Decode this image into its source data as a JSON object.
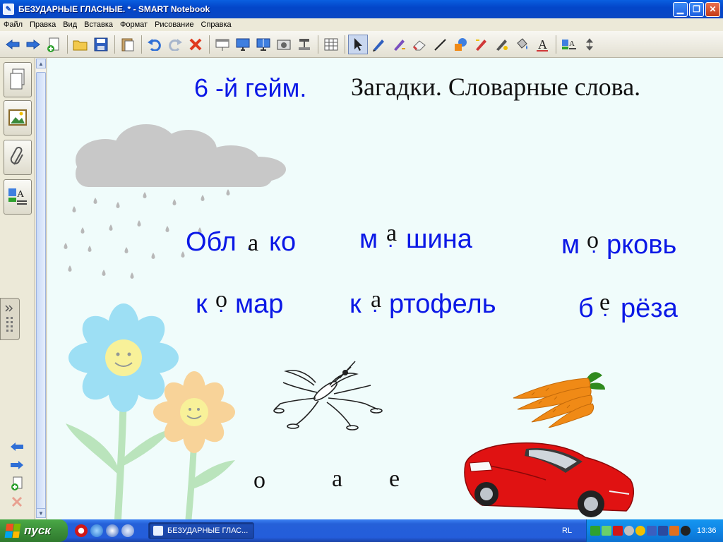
{
  "window": {
    "title": "БЕЗУДАРНЫЕ ГЛАСНЫЕ. * - SMART Notebook",
    "minimize_icon": "minimize-icon",
    "maximize_icon": "restore-icon",
    "close_icon": "close-icon"
  },
  "menu": [
    "Файл",
    "Правка",
    "Вид",
    "Вставка",
    "Формат",
    "Рисование",
    "Справка"
  ],
  "page": {
    "heading_game": "6 -й гейм.",
    "heading_topic": "Загадки. Словарные слова.",
    "words": [
      {
        "prefix": "Обл",
        "missing": "а",
        "suffix": "ко"
      },
      {
        "prefix": "м",
        "missing": "а",
        "suffix": "шина"
      },
      {
        "prefix": "м",
        "missing": "о",
        "suffix": "рковь"
      },
      {
        "prefix": "к",
        "missing": "о",
        "suffix": "мар"
      },
      {
        "prefix": "к",
        "missing": "а",
        "suffix": "ртофель"
      },
      {
        "prefix": "б",
        "missing": "е",
        "suffix": "рёза"
      }
    ],
    "letter_choices": [
      "о",
      "а",
      "е"
    ],
    "colors": {
      "word_blue": "#0b18e6",
      "background": "#f0fcfb",
      "cloud": "#c8c8c8",
      "carrot": "#f08a16",
      "car": "#e01212"
    }
  },
  "taskbar": {
    "start_label": "пуск",
    "task_button": "БЕЗУДАРНЫЕ ГЛАС...",
    "language": "RL",
    "clock": "13:36"
  }
}
